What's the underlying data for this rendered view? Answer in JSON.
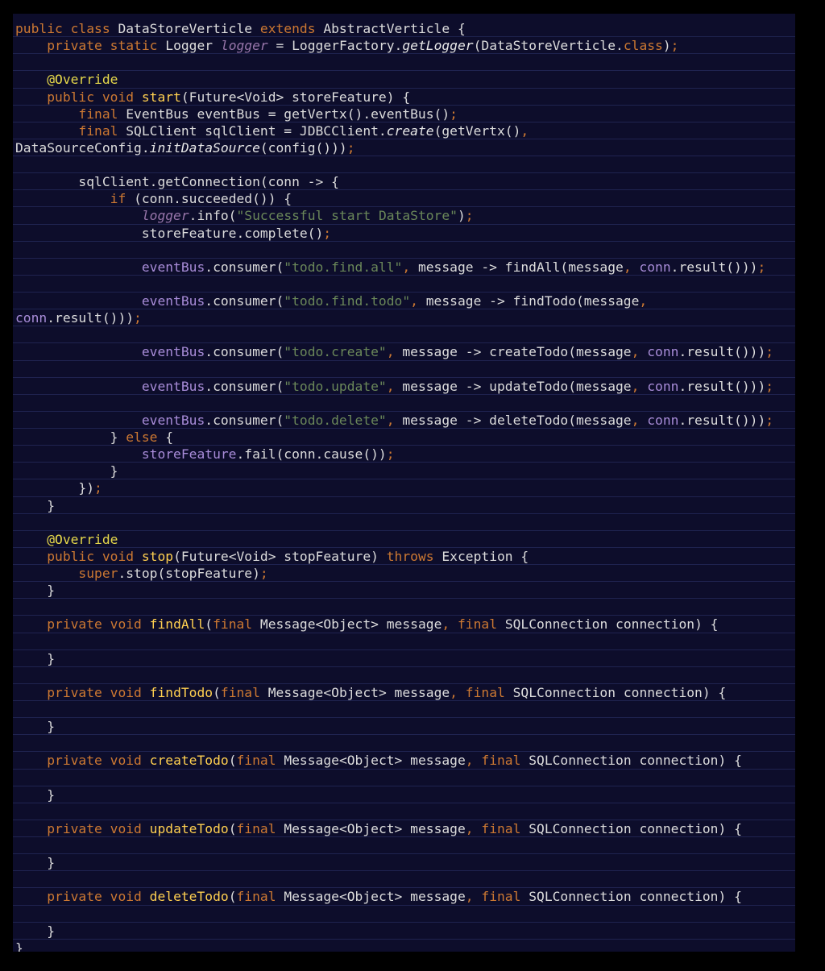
{
  "theme": {
    "background": "#0d0d2b",
    "outer": "#000000",
    "line_rule": "#1f2350",
    "colors": {
      "kw": "#cc7832",
      "id": "#dcdcdc",
      "fn": "#ffd050",
      "ann": "#e6d84a",
      "str": "#6a8759",
      "sfld": "#9876aa",
      "fld": "#a88cd8"
    }
  },
  "code_lines": [
    [
      [
        "kw",
        "public class "
      ],
      [
        "id",
        "DataStoreVerticle "
      ],
      [
        "kw",
        "extends "
      ],
      [
        "id",
        "AbstractVerticle {"
      ]
    ],
    [
      [
        "id",
        "    "
      ],
      [
        "kw",
        "private static "
      ],
      [
        "id",
        "Logger "
      ],
      [
        "sfld",
        "logger"
      ],
      [
        "id",
        " = LoggerFactory."
      ],
      [
        "smet",
        "getLogger"
      ],
      [
        "id",
        "(DataStoreVerticle."
      ],
      [
        "kw",
        "class"
      ],
      [
        "id",
        ")"
      ],
      [
        "pun",
        ";"
      ]
    ],
    [],
    [
      [
        "id",
        "    "
      ],
      [
        "ann",
        "@Override"
      ]
    ],
    [
      [
        "id",
        "    "
      ],
      [
        "kw",
        "public void "
      ],
      [
        "fn",
        "start"
      ],
      [
        "id",
        "(Future<Void> storeFeature) {"
      ]
    ],
    [
      [
        "id",
        "        "
      ],
      [
        "kw",
        "final "
      ],
      [
        "id",
        "EventBus eventBus = getVertx().eventBus()"
      ],
      [
        "pun",
        ";"
      ]
    ],
    [
      [
        "id",
        "        "
      ],
      [
        "kw",
        "final "
      ],
      [
        "id",
        "SQLClient sqlClient = JDBCClient."
      ],
      [
        "smet",
        "create"
      ],
      [
        "id",
        "(getVertx()"
      ],
      [
        "pun",
        ","
      ]
    ],
    [
      [
        "id",
        "DataSourceConfig."
      ],
      [
        "smet",
        "initDataSource"
      ],
      [
        "id",
        "(config()))"
      ],
      [
        "pun",
        ";"
      ]
    ],
    [],
    [
      [
        "id",
        "        sqlClient.getConnection(conn -> {"
      ]
    ],
    [
      [
        "id",
        "            "
      ],
      [
        "kw",
        "if "
      ],
      [
        "id",
        "(conn.succeeded()) {"
      ]
    ],
    [
      [
        "id",
        "                "
      ],
      [
        "sfld",
        "logger"
      ],
      [
        "id",
        ".info("
      ],
      [
        "str",
        "\"Successful start DataStore\""
      ],
      [
        "id",
        ")"
      ],
      [
        "pun",
        ";"
      ]
    ],
    [
      [
        "id",
        "                storeFeature.complete()"
      ],
      [
        "pun",
        ";"
      ]
    ],
    [],
    [
      [
        "id",
        "                "
      ],
      [
        "fld",
        "eventBus"
      ],
      [
        "id",
        ".consumer("
      ],
      [
        "str",
        "\"todo.find.all\""
      ],
      [
        "pun",
        ", "
      ],
      [
        "id",
        "message -> findAll(message"
      ],
      [
        "pun",
        ", "
      ],
      [
        "fld",
        "conn"
      ],
      [
        "id",
        ".result()))"
      ],
      [
        "pun",
        ";"
      ]
    ],
    [],
    [
      [
        "id",
        "                "
      ],
      [
        "fld",
        "eventBus"
      ],
      [
        "id",
        ".consumer("
      ],
      [
        "str",
        "\"todo.find.todo\""
      ],
      [
        "pun",
        ", "
      ],
      [
        "id",
        "message -> findTodo(message"
      ],
      [
        "pun",
        ","
      ]
    ],
    [
      [
        "fld",
        "conn"
      ],
      [
        "id",
        ".result()))"
      ],
      [
        "pun",
        ";"
      ]
    ],
    [],
    [
      [
        "id",
        "                "
      ],
      [
        "fld",
        "eventBus"
      ],
      [
        "id",
        ".consumer("
      ],
      [
        "str",
        "\"todo.create\""
      ],
      [
        "pun",
        ", "
      ],
      [
        "id",
        "message -> createTodo(message"
      ],
      [
        "pun",
        ", "
      ],
      [
        "fld",
        "conn"
      ],
      [
        "id",
        ".result()))"
      ],
      [
        "pun",
        ";"
      ]
    ],
    [],
    [
      [
        "id",
        "                "
      ],
      [
        "fld",
        "eventBus"
      ],
      [
        "id",
        ".consumer("
      ],
      [
        "str",
        "\"todo.update\""
      ],
      [
        "pun",
        ", "
      ],
      [
        "id",
        "message -> updateTodo(message"
      ],
      [
        "pun",
        ", "
      ],
      [
        "fld",
        "conn"
      ],
      [
        "id",
        ".result()))"
      ],
      [
        "pun",
        ";"
      ]
    ],
    [],
    [
      [
        "id",
        "                "
      ],
      [
        "fld",
        "eventBus"
      ],
      [
        "id",
        ".consumer("
      ],
      [
        "str",
        "\"todo.delete\""
      ],
      [
        "pun",
        ", "
      ],
      [
        "id",
        "message -> deleteTodo(message"
      ],
      [
        "pun",
        ", "
      ],
      [
        "fld",
        "conn"
      ],
      [
        "id",
        ".result()))"
      ],
      [
        "pun",
        ";"
      ]
    ],
    [
      [
        "id",
        "            } "
      ],
      [
        "kw",
        "else "
      ],
      [
        "id",
        "{"
      ]
    ],
    [
      [
        "id",
        "                "
      ],
      [
        "fld",
        "storeFeature"
      ],
      [
        "id",
        ".fail(conn.cause())"
      ],
      [
        "pun",
        ";"
      ]
    ],
    [
      [
        "id",
        "            }"
      ]
    ],
    [
      [
        "id",
        "        })"
      ],
      [
        "pun",
        ";"
      ]
    ],
    [
      [
        "id",
        "    }"
      ]
    ],
    [],
    [
      [
        "id",
        "    "
      ],
      [
        "ann",
        "@Override"
      ]
    ],
    [
      [
        "id",
        "    "
      ],
      [
        "kw",
        "public void "
      ],
      [
        "fn",
        "stop"
      ],
      [
        "id",
        "(Future<Void> stopFeature) "
      ],
      [
        "kw",
        "throws "
      ],
      [
        "id",
        "Exception {"
      ]
    ],
    [
      [
        "id",
        "        "
      ],
      [
        "kw",
        "super"
      ],
      [
        "id",
        ".stop(stopFeature)"
      ],
      [
        "pun",
        ";"
      ]
    ],
    [
      [
        "id",
        "    }"
      ]
    ],
    [],
    [
      [
        "id",
        "    "
      ],
      [
        "kw",
        "private void "
      ],
      [
        "fn",
        "findAll"
      ],
      [
        "id",
        "("
      ],
      [
        "kw",
        "final "
      ],
      [
        "id",
        "Message<Object> message"
      ],
      [
        "pun",
        ", "
      ],
      [
        "kw",
        "final "
      ],
      [
        "id",
        "SQLConnection connection) {"
      ]
    ],
    [],
    [
      [
        "id",
        "    }"
      ]
    ],
    [],
    [
      [
        "id",
        "    "
      ],
      [
        "kw",
        "private void "
      ],
      [
        "fn",
        "findTodo"
      ],
      [
        "id",
        "("
      ],
      [
        "kw",
        "final "
      ],
      [
        "id",
        "Message<Object> message"
      ],
      [
        "pun",
        ", "
      ],
      [
        "kw",
        "final "
      ],
      [
        "id",
        "SQLConnection connection) {"
      ]
    ],
    [],
    [
      [
        "id",
        "    }"
      ]
    ],
    [],
    [
      [
        "id",
        "    "
      ],
      [
        "kw",
        "private void "
      ],
      [
        "fn",
        "createTodo"
      ],
      [
        "id",
        "("
      ],
      [
        "kw",
        "final "
      ],
      [
        "id",
        "Message<Object> message"
      ],
      [
        "pun",
        ", "
      ],
      [
        "kw",
        "final "
      ],
      [
        "id",
        "SQLConnection connection) {"
      ]
    ],
    [],
    [
      [
        "id",
        "    }"
      ]
    ],
    [],
    [
      [
        "id",
        "    "
      ],
      [
        "kw",
        "private void "
      ],
      [
        "fn",
        "updateTodo"
      ],
      [
        "id",
        "("
      ],
      [
        "kw",
        "final "
      ],
      [
        "id",
        "Message<Object> message"
      ],
      [
        "pun",
        ", "
      ],
      [
        "kw",
        "final "
      ],
      [
        "id",
        "SQLConnection connection) {"
      ]
    ],
    [],
    [
      [
        "id",
        "    }"
      ]
    ],
    [],
    [
      [
        "id",
        "    "
      ],
      [
        "kw",
        "private void "
      ],
      [
        "fn",
        "deleteTodo"
      ],
      [
        "id",
        "("
      ],
      [
        "kw",
        "final "
      ],
      [
        "id",
        "Message<Object> message"
      ],
      [
        "pun",
        ", "
      ],
      [
        "kw",
        "final "
      ],
      [
        "id",
        "SQLConnection connection) {"
      ]
    ],
    [],
    [
      [
        "id",
        "    }"
      ]
    ],
    [
      [
        "id",
        "}"
      ]
    ]
  ]
}
